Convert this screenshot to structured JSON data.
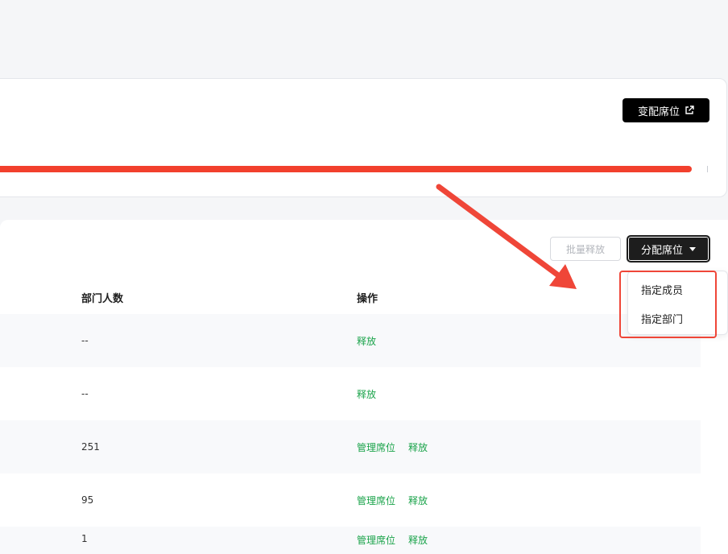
{
  "seat_card": {
    "change_seat_label": "变配席位",
    "progress_fraction": 0.98
  },
  "toolbar": {
    "batch_release_label": "批量释放",
    "assign_seat_label": "分配席位"
  },
  "table": {
    "headers": {
      "dept_count": "部门人数",
      "operations": "操作"
    },
    "rows": [
      {
        "count": "--",
        "ops": [
          "释放"
        ]
      },
      {
        "count": "--",
        "ops": [
          "释放"
        ]
      },
      {
        "count": "251",
        "ops": [
          "管理席位",
          "释放"
        ]
      },
      {
        "count": "95",
        "ops": [
          "管理席位",
          "释放"
        ]
      },
      {
        "count": "1",
        "ops": [
          "管理席位",
          "释放"
        ]
      }
    ]
  },
  "dropdown": {
    "items": [
      "指定成员",
      "指定部门"
    ]
  },
  "colors": {
    "accent_green": "#1aa34a",
    "annotation_red": "#ef4638",
    "progress_red": "#f2402d"
  }
}
